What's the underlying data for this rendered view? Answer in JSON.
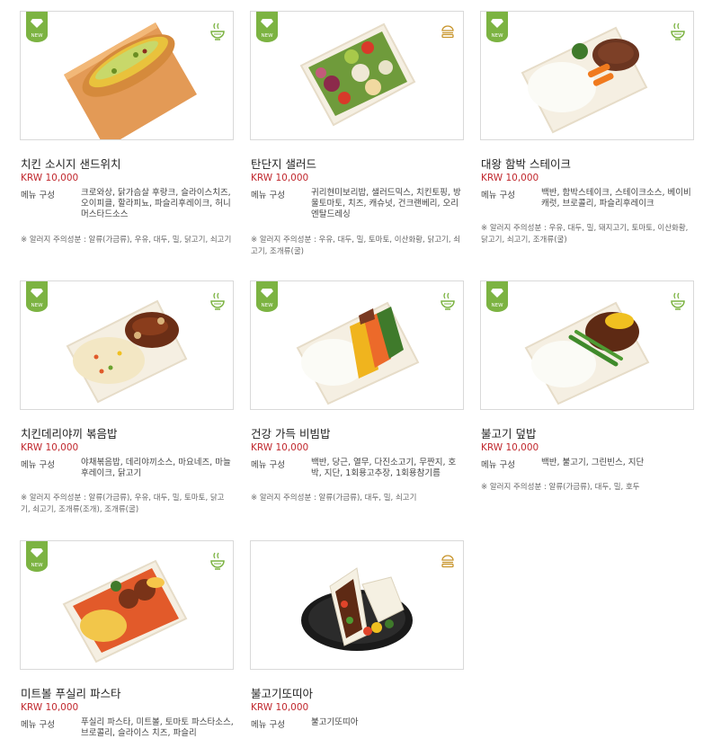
{
  "currency_label": "KRW",
  "composition_label": "메뉴 구성",
  "badge_text": "NEW",
  "colors": {
    "badge": "#7cb342",
    "price": "#c0272d",
    "border": "#d9d9d9"
  },
  "items": [
    {
      "name": "치킨 소시지 샌드위치",
      "price": "KRW 10,000",
      "composition": "크로와상, 닭가슴살 후랑크, 슬라이스치즈, 오이피클, 할라피뇨, 파슬리후레이크, 허니머스타드소스",
      "allergy": "※ 알러지 주의성분 : 알류(가금류), 우유, 대두, 밀, 닭고기, 쇠고기",
      "new": true,
      "icon": "bowl-icon"
    },
    {
      "name": "탄단지 샐러드",
      "price": "KRW 10,000",
      "composition": "귀리현미보리밥, 샐러드믹스, 치킨토핑, 방울토마토, 치즈, 캐슈넛, 건크랜베리, 오리엔탈드레싱",
      "allergy": "※ 알러지 주의성분 : 우유, 대두, 밀, 토마토, 이산화황, 닭고기, 쇠고기, 조개류(굴)",
      "new": true,
      "icon": "burger-icon"
    },
    {
      "name": "대왕 함박 스테이크",
      "price": "KRW 10,000",
      "composition": "백반, 함박스테이크, 스테이크소스, 베이비캐럿, 브로콜리, 파슬리후레이크",
      "allergy": "※ 알러지 주의성분 : 우유, 대두, 밀, 돼지고기, 토마토, 이산화황, 닭고기, 쇠고기, 조개류(굴)",
      "new": true,
      "icon": "bowl-icon"
    },
    {
      "name": "치킨데리야끼 볶음밥",
      "price": "KRW 10,000",
      "composition": "야채볶음밥, 데리야끼소스, 마요네즈, 마늘후레이크, 닭고기",
      "allergy": "※ 알러지 주의성분 : 알류(가금류), 우유, 대두, 밀, 토마토, 닭고기, 쇠고기, 조개류(조개), 조개류(굴)",
      "new": true,
      "icon": "bowl-icon"
    },
    {
      "name": "건강 가득 비빔밥",
      "price": "KRW 10,000",
      "composition": "백반, 당근, 열무, 다진소고기, 무짠지, 호박, 지단, 1회용고추장, 1회용참기름",
      "allergy": "※ 알러지 주의성분 : 알류(가금류), 대두, 밀, 쇠고기",
      "new": true,
      "icon": "bowl-icon"
    },
    {
      "name": "불고기 덮밥",
      "price": "KRW 10,000",
      "composition": "백반, 불고기, 그린빈스, 지단",
      "allergy": "※ 알러지 주의성분 : 알류(가금류), 대두, 밀, 호두",
      "new": true,
      "icon": "bowl-icon"
    },
    {
      "name": "미트볼 푸실리 파스타",
      "price": "KRW 10,000",
      "composition": "푸실리 파스타, 미트볼, 토마토 파스타소스, 브로콜리, 슬라이스 치즈, 파슬리",
      "allergy": "",
      "new": true,
      "icon": "bowl-icon"
    },
    {
      "name": "불고기또띠아",
      "price": "KRW 10,000",
      "composition": "불고기또띠아",
      "allergy": "",
      "new": false,
      "icon": "burger-icon"
    }
  ]
}
